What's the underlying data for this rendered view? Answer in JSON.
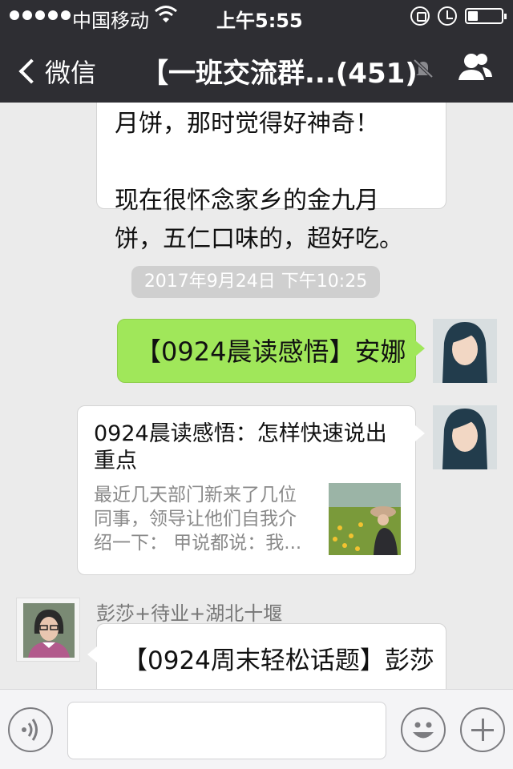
{
  "status_bar": {
    "carrier": "中国移动",
    "time": "上午5:55",
    "battery_level": 0.3
  },
  "nav": {
    "back_label": "微信",
    "title": "【一班交流群...(451)"
  },
  "messages": {
    "prev_text_line1": "月饼，那时觉得好神奇！",
    "prev_text_line2": "现在很怀念家乡的金九月",
    "prev_text_line3": "饼，五仁口味的，超好吃。",
    "timestamp": "2017年9月24日 下午10:25",
    "green_bubble": "【0924晨读感悟】安娜",
    "card_title": "0924晨读感悟：怎样快速说出重点",
    "card_desc": "最近几天部门新来了几位同事，领导让他们自我介绍一下： 甲说都说：我...",
    "sender_name": "彭莎+待业+湖北十堰",
    "incoming_text": "【0924周末轻松话题】彭莎"
  },
  "icons": {
    "back": "chevron-left-icon",
    "mute": "bell-muted-icon",
    "members": "people-icon",
    "voice": "voice-icon",
    "emoji": "emoji-icon",
    "plus": "plus-icon"
  },
  "colors": {
    "bar": "#2e2e33",
    "bubble_green": "#a0e75a",
    "background": "#ebebeb"
  }
}
